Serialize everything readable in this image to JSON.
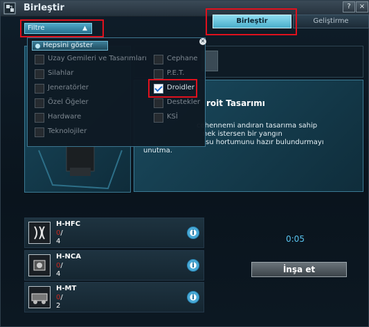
{
  "window": {
    "title": "Birleştir",
    "help_label": "?",
    "close_label": "×"
  },
  "tabs": [
    {
      "label": "Birleştir",
      "active": true
    },
    {
      "label": "Geliştirme",
      "active": false
    }
  ],
  "filter": {
    "button_label": "Filtre",
    "show_all_label": "Hepsini göster",
    "options_left": [
      {
        "label": "Uzay Gemileri ve Tasarımları",
        "checked": false
      },
      {
        "label": "Silahlar",
        "checked": false
      },
      {
        "label": "Jeneratörler",
        "checked": false
      },
      {
        "label": "Özel Öğeler",
        "checked": false
      },
      {
        "label": "Hardware",
        "checked": false
      },
      {
        "label": "Teknolojiler",
        "checked": false
      }
    ],
    "options_right": [
      {
        "label": "Cephane",
        "checked": false
      },
      {
        "label": "P.E.T.",
        "checked": false
      },
      {
        "label": "Droidler",
        "checked": true
      },
      {
        "label": "Destekler",
        "checked": false
      },
      {
        "label": "KSİ",
        "checked": false
      }
    ]
  },
  "design": {
    "title_fragment": "roit Tasarımı",
    "description_lines": [
      "cehennemi andıran tasarıma sahip",
      "nek istersen bir yangın",
      "su hortumunu hazır bulundurmayı",
      "unutma."
    ]
  },
  "items": [
    {
      "name": "H-HFC",
      "have": "0",
      "need": "4",
      "icon": "hfc-component-icon"
    },
    {
      "name": "H-NCA",
      "have": "0",
      "need": "4",
      "icon": "nca-component-icon"
    },
    {
      "name": "H-MT",
      "have": "0",
      "need": "2",
      "icon": "mt-component-icon"
    }
  ],
  "timer": "0:05",
  "build_button_label": "İnşa et",
  "colors": {
    "accent": "#4aaecb",
    "highlight": "#e0111d",
    "insufficient": "#c7281f",
    "timer": "#59c4ef"
  }
}
